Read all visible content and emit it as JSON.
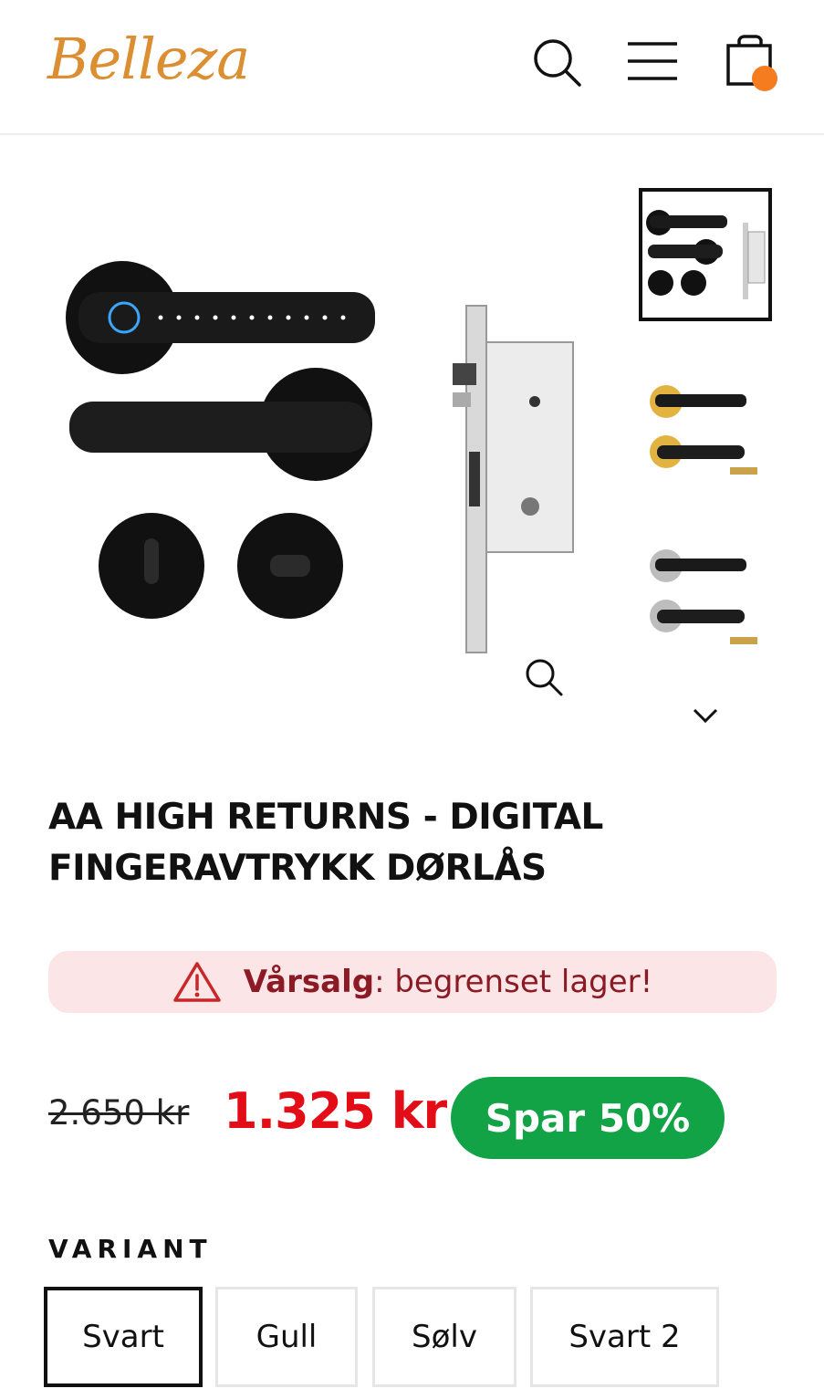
{
  "header": {
    "logo_text": "Belleza",
    "cart_badge_color": "#f57c1f",
    "icons": [
      "search-icon",
      "menu-icon",
      "shopping-bag-icon"
    ]
  },
  "gallery": {
    "thumbnails": [
      "Black",
      "Gold",
      "Silver"
    ],
    "active_thumbnail": 0,
    "icons": [
      "zoom-icon",
      "chevron-down-icon"
    ]
  },
  "product": {
    "title": "AA HIGH RETURNS - DIGITAL FINGERAVTRYKK DØRLÅS"
  },
  "alert": {
    "strong": "Vårsalg",
    "text": ": begrenset lager!",
    "icon": "warning-icon"
  },
  "price": {
    "compare_at": "2.650 kr",
    "current": "1.325 kr",
    "save_badge": "Spar 50%",
    "colors": {
      "sale": "#e30d18",
      "badge": "#12a346"
    }
  },
  "variant": {
    "label": "VARIANT",
    "options": [
      "Svart",
      "Gull",
      "Sølv",
      "Svart 2"
    ],
    "selected": "Svart"
  }
}
